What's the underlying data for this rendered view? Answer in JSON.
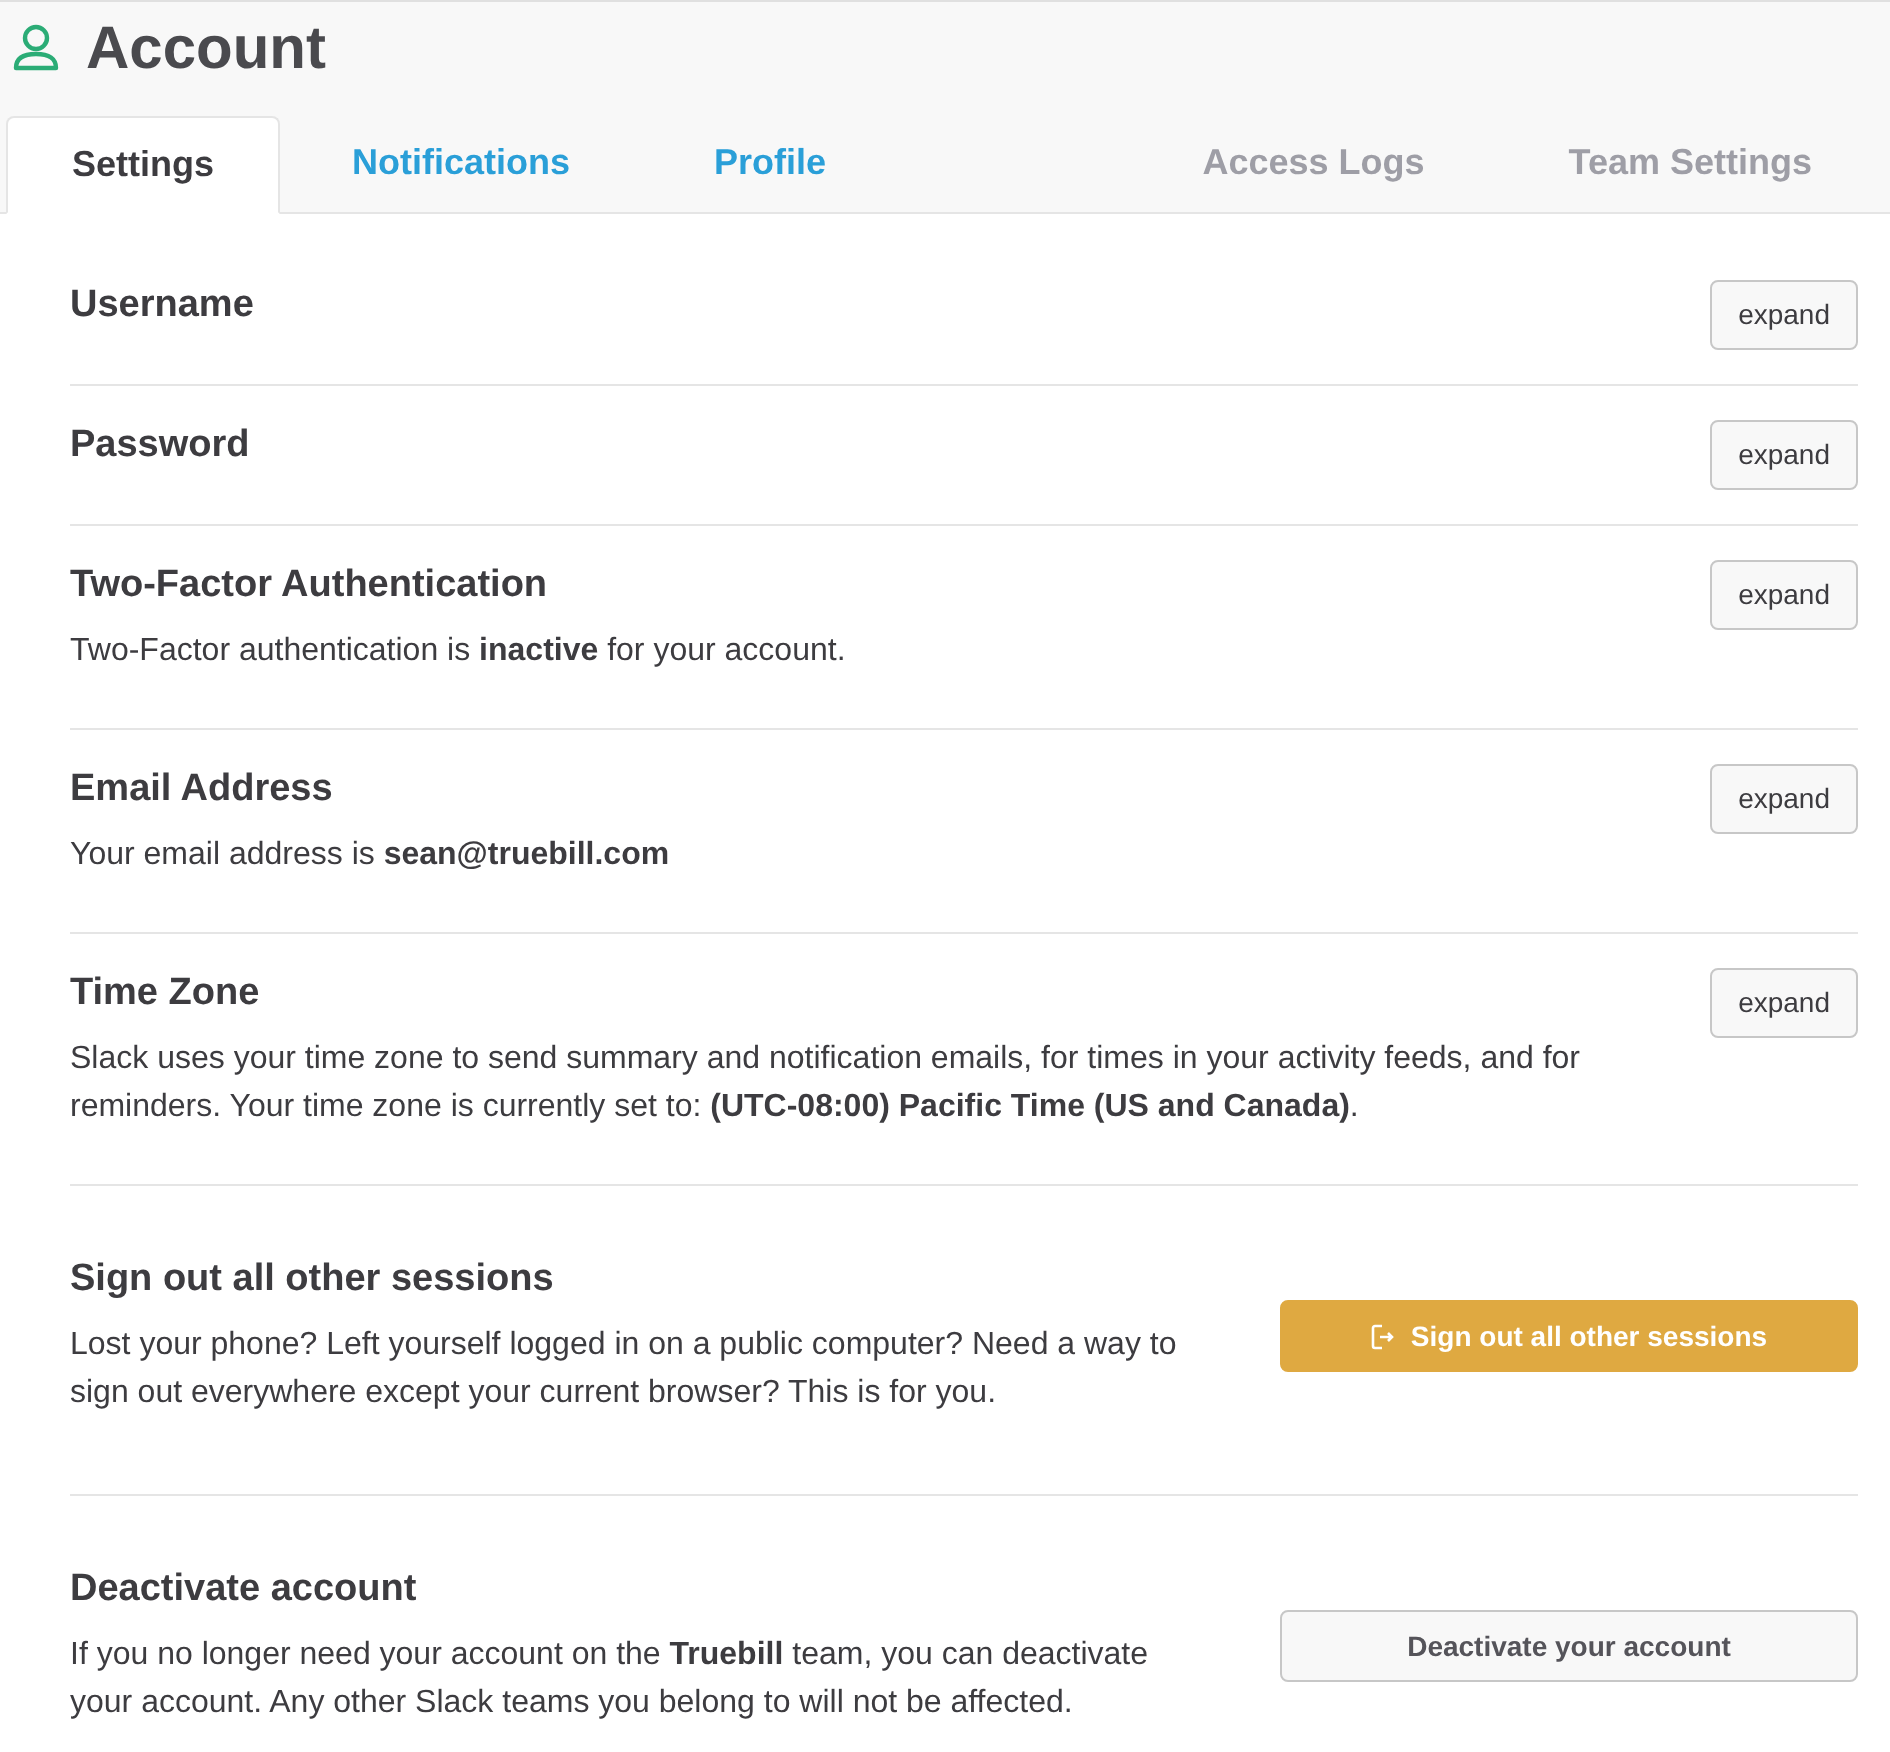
{
  "header": {
    "title": "Account"
  },
  "tabs": [
    {
      "label": "Settings",
      "selected": true,
      "kind": "primary"
    },
    {
      "label": "Notifications",
      "selected": false,
      "kind": "primary"
    },
    {
      "label": "Profile",
      "selected": false,
      "kind": "primary"
    },
    {
      "label": "Access Logs",
      "selected": false,
      "kind": "admin"
    },
    {
      "label": "Team Settings",
      "selected": false,
      "kind": "admin"
    }
  ],
  "sections": [
    {
      "kind": "expand",
      "title": "Username",
      "button": "expand"
    },
    {
      "kind": "expand",
      "title": "Password",
      "button": "expand"
    },
    {
      "kind": "expand",
      "title": "Two-Factor Authentication",
      "description": "Two-Factor authentication is **inactive** for your account.",
      "button": "expand"
    },
    {
      "kind": "expand",
      "title": "Email Address",
      "description": "Your email address is **sean@truebill.com**",
      "button": "expand"
    },
    {
      "kind": "expand",
      "title": "Time Zone",
      "description": "Slack uses your time zone to send summary and notification emails, for times in your activity feeds, and for reminders. Your time zone is currently set to: **(UTC-08:00) Pacific Time (US and Canada)**.",
      "button": "expand"
    },
    {
      "kind": "warning",
      "title": "Sign out all other sessions",
      "description": "Lost your phone? Left yourself logged in on a public computer? Need a way to sign out everywhere except your current browser? This is for you.",
      "button": "Sign out all other sessions"
    },
    {
      "kind": "action",
      "title": "Deactivate account",
      "description": "If you no longer need your account on the **Truebill** team, you can deactivate your account. Any other Slack teams you belong to will not be affected.",
      "button": "Deactivate your account"
    }
  ]
}
